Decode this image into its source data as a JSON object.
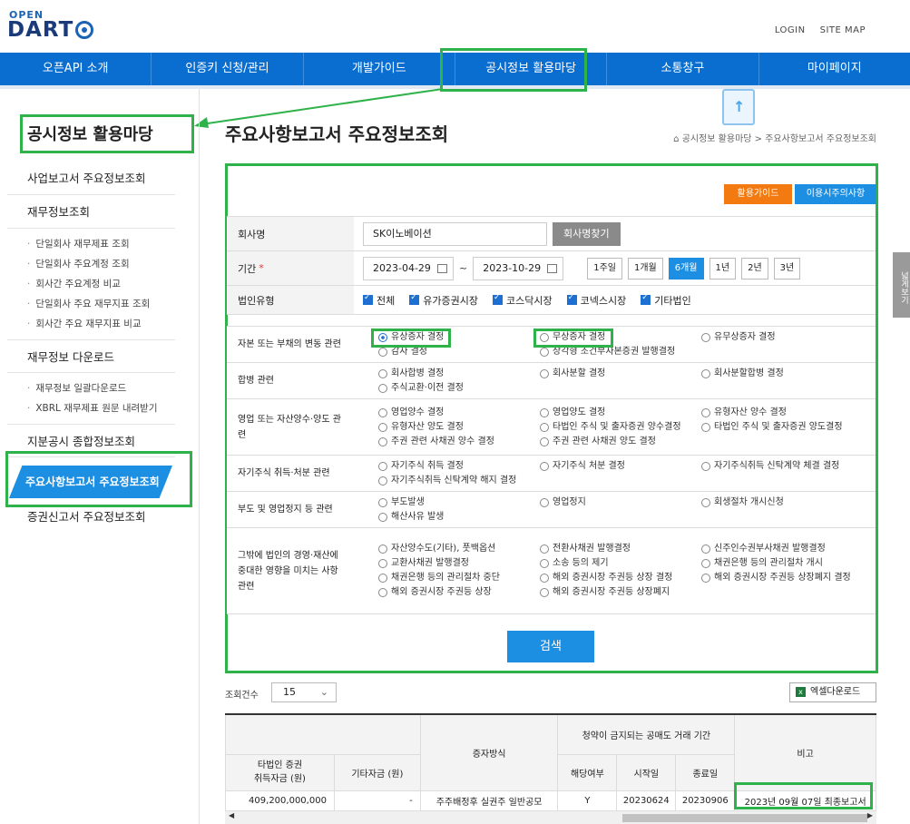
{
  "logo": {
    "top": "OPEN",
    "main": "DART"
  },
  "top_links": [
    "LOGIN",
    "SITE MAP"
  ],
  "gnb": [
    "오픈API 소개",
    "인증키 신청/관리",
    "개발가이드",
    "공시정보 활용마당",
    "소통창구",
    "마이페이지"
  ],
  "side_title": "공시정보 활용마당",
  "sidebar": {
    "sec1": "사업보고서 주요정보조회",
    "sec2": "재무정보조회",
    "sec2_subs": [
      "단일회사 재무제표 조회",
      "단일회사 주요계정 조회",
      "회사간 주요계정 비교",
      "단일회사 주요 재무지표 조회",
      "회사간 주요 재무지표 비교"
    ],
    "sec3": "재무정보 다운로드",
    "sec3_subs": [
      "재무정보 일괄다운로드",
      "XBRL 재무제표 원문 내려받기"
    ],
    "sec4": "지분공시 종합정보조회",
    "active": "주요사항보고서 주요정보조회",
    "sec6": "증권신고서 주요정보조회"
  },
  "page_title": "주요사항보고서 주요정보조회",
  "breadcrumb": "공시정보 활용마당 > 주요사항보고서 주요정보조회",
  "buttons": {
    "guide": "활용가이드",
    "notice": "이용시주의사항",
    "find_company": "회사명찾기",
    "search": "검색",
    "excel": "엑셀다운로드"
  },
  "form": {
    "company_label": "회사명",
    "company_value": "SK이노베이션",
    "period_label": "기간",
    "date_from": "2023-04-29",
    "tilde": "~",
    "date_to": "2023-10-29",
    "periods": [
      "1주일",
      "1개월",
      "6개월",
      "1년",
      "2년",
      "3년"
    ],
    "type_label": "법인유형",
    "types": [
      "전체",
      "유가증권시장",
      "코스닥시장",
      "코넥스시장",
      "기타법인"
    ]
  },
  "categories": [
    {
      "label": "자본 또는 부채의 변동 관련",
      "items": [
        "유상증자 결정",
        "무상증자 결정",
        "유무상증자 결정",
        "감자 결정",
        "상각형 조건부자본증권 발행결정"
      ]
    },
    {
      "label": "합병 관련",
      "items": [
        "회사합병 결정",
        "회사분할 결정",
        "회사분할합병 결정",
        "주식교환·이전 결정"
      ]
    },
    {
      "label": "영업 또는 자산양수·양도 관련",
      "items": [
        "영업양수 결정",
        "영업양도 결정",
        "유형자산 양수 결정",
        "유형자산 양도 결정",
        "타법인 주식 및 출자증권 양수결정",
        "타법인 주식 및 출자증권 양도결정",
        "주권 관련 사채권 양수 결정",
        "주권 관련 사채권 양도 결정"
      ]
    },
    {
      "label": "자기주식 취득·처분 관련",
      "items": [
        "자기주식 취득 결정",
        "자기주식 처분 결정",
        "자기주식취득 신탁계약 체결 결정",
        "자기주식취득 신탁계약 해지 결정"
      ]
    },
    {
      "label": "부도 및 영업정지 등 관련",
      "items": [
        "부도발생",
        "영업정지",
        "회생절차 개시신청",
        "해산사유 발생"
      ]
    },
    {
      "label": "그밖에 법인의 경영·재산에 중대한 영향을 미치는 사항 관련",
      "items": [
        "자산양수도(기타), 풋백옵션",
        "전환사채권 발행결정",
        "신주인수권부사채권 발행결정",
        "교환사채권 발행결정",
        "소송 등의 제기",
        "채권은행 등의 관리절차 개시",
        "채권은행 등의 관리절차 중단",
        "해외 증권시장 주권등 상장 결정",
        "해외 증권시장 주권등 상장폐지 결정",
        "해외 증권시장 주권등 상장",
        "해외 증권시장 주권등 상장폐지"
      ]
    }
  ],
  "count_label": "조회건수",
  "count_value": "15",
  "table": {
    "h_method": "증자방식",
    "h_ban": "청약이 금지되는 공매도 거래 기간",
    "h_note": "비고",
    "h_col1": "타법인 증권\n취득자금 (원)",
    "h_col2": "기타자금 (원)",
    "h_ban_yn": "해당여부",
    "h_start": "시작일",
    "h_end": "종료일",
    "row": [
      "409,200,000,000",
      "-",
      "주주배정후 실권주 일반공모",
      "Y",
      "20230624",
      "20230906",
      "2023년 09월 07일 최종보고서"
    ]
  },
  "side_tab": "넓게보기"
}
